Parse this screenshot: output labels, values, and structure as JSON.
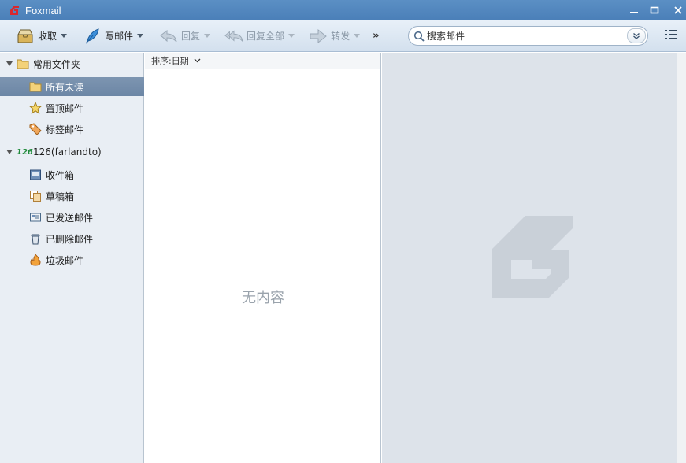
{
  "window": {
    "title": "Foxmail"
  },
  "toolbar": {
    "receive_label": "收取",
    "compose_label": "写邮件",
    "reply_label": "回复",
    "reply_all_label": "回复全部",
    "forward_label": "转发",
    "more_label": "»",
    "search_placeholder": "搜索邮件"
  },
  "sidebar": {
    "favorites": {
      "label": "常用文件夹",
      "items": [
        {
          "label": "所有未读",
          "icon": "folder-icon",
          "selected": true
        },
        {
          "label": "置顶邮件",
          "icon": "star-icon"
        },
        {
          "label": "标签邮件",
          "icon": "tag-icon"
        }
      ]
    },
    "account": {
      "badge": "126",
      "label": "126(farlandto)",
      "items": [
        {
          "label": "收件箱",
          "icon": "inbox-icon"
        },
        {
          "label": "草稿箱",
          "icon": "drafts-icon"
        },
        {
          "label": "已发送邮件",
          "icon": "sent-icon"
        },
        {
          "label": "已删除邮件",
          "icon": "trash-icon"
        },
        {
          "label": "垃圾邮件",
          "icon": "spam-icon"
        }
      ]
    }
  },
  "maillist": {
    "sort_label": "排序:日期",
    "empty_text": "无内容"
  },
  "colors": {
    "titlebar": "#4a7fb8",
    "selected_row": "#7089a8",
    "reader_bg": "#dde3ea"
  }
}
